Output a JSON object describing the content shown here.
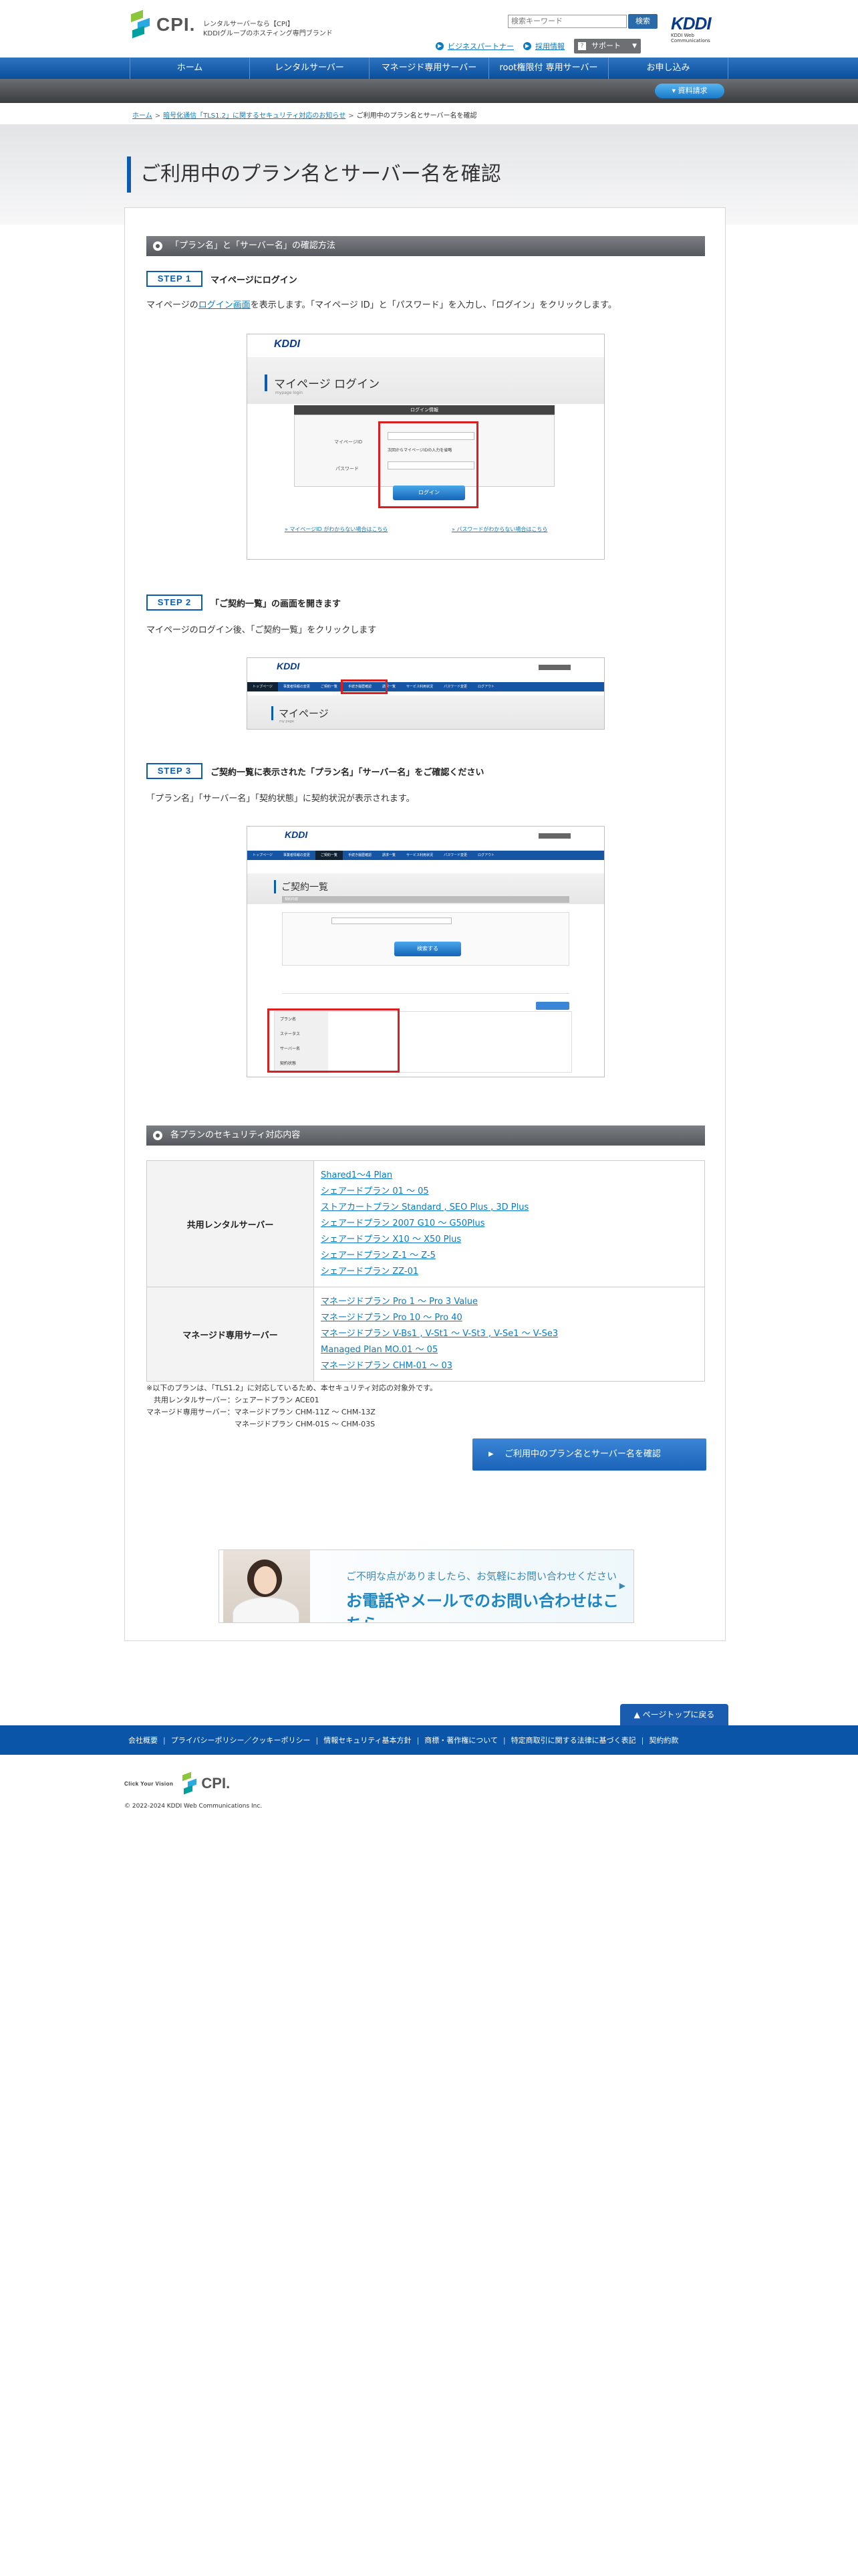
{
  "header": {
    "logo_text": "CPI.",
    "tagline_1": "レンタルサーバーなら【CPI】",
    "tagline_2": "KDDIグループのホスティング専門ブランド",
    "search_placeholder": "検索キーワード",
    "search_button": "検索",
    "kddi_logo": "KDDI",
    "kddi_sub": "KDDI Web Communications",
    "links": [
      "ビジネスパートナー",
      "採用情報"
    ],
    "support_label": "サポート"
  },
  "nav": {
    "items": [
      "ホーム",
      "レンタルサーバー",
      "マネージド専用サーバー",
      "root権限付 専用サーバー",
      "お申し込み"
    ],
    "subbar_button": "資料請求"
  },
  "breadcrumb": {
    "home": "ホーム",
    "parent": "暗号化通信「TLS1.2」に関するセキュリティ対応のお知らせ",
    "current": "ご利用中のプラン名とサーバー名を確認"
  },
  "page_title": "ご利用中のプラン名とサーバー名を確認",
  "section1": {
    "heading": "「プラン名」と「サーバー名」の確認方法",
    "step1": {
      "badge": "STEP 1",
      "title": "マイページにログイン",
      "desc_prefix": "マイページの",
      "desc_link": "ログイン画面",
      "desc_suffix": "を表示します。「マイページ ID」と「パスワード」を入力し、「ログイン」をクリックします。"
    },
    "step2": {
      "badge": "STEP 2",
      "title": "「ご契約一覧」の画面を開きます",
      "desc": "マイページのログイン後、「ご契約一覧」をクリックします"
    },
    "step3": {
      "badge": "STEP 3",
      "title": "ご契約一覧に表示された「プラン名」「サーバー名」をご確認ください",
      "desc": "「プラン名」「サーバー名」「契約状態」に契約状況が表示されます。"
    }
  },
  "shot_login": {
    "kddi": "KDDI",
    "title": "マイページ ログイン",
    "sub": "mypage login",
    "panel_title": "ログイン情報",
    "field1": "マイページID",
    "field2": "パスワード",
    "remember": "次回からマイページIDの入力を省略",
    "button": "ログイン",
    "link1": "マイページID がわからない場合はこちら",
    "link2": "パスワードがわからない場合はこちら"
  },
  "shot_mypage": {
    "kddi": "KDDI",
    "title": "マイページ",
    "sub": "my page",
    "nav": [
      "トップページ",
      "事業者情報の変更",
      "ご契約一覧",
      "手続き履歴確認",
      "請求一覧",
      "サービス利用状況",
      "パスワード変更",
      "ログアウト"
    ]
  },
  "shot_contract": {
    "kddi": "KDDI",
    "title": "ご契約一覧",
    "sub": "契約内容",
    "search_button": "検索する",
    "rows": [
      "プラン名",
      "ステータス",
      "サーバー名",
      "契約状態"
    ]
  },
  "section2": {
    "heading": "各プランのセキュリティ対応内容",
    "rows": [
      {
        "label": "共用レンタルサーバー",
        "links": [
          "Shared1～4 Plan",
          "シェアードプラン 01 ～ 05",
          "ストアカートプラン Standard , SEO Plus , 3D Plus",
          "シェアードプラン 2007 G10 ～ G50Plus",
          "シェアードプラン X10 ～ X50 Plus",
          "シェアードプラン Z-1 ～ Z-5",
          "シェアードプラン ZZ-01"
        ]
      },
      {
        "label": "マネージド専用サーバー",
        "links": [
          "マネージドプラン Pro 1 ～ Pro 3 Value",
          "マネージドプラン Pro 10 ～ Pro 40",
          "マネージドプラン V-Bs1 , V-St1 ～ V-St3 , V-Se1 ～ V-Se3",
          "Managed Plan MO.01 ～ 05",
          "マネージドプラン CHM-01 ～ 03"
        ]
      }
    ],
    "note": "※以下のプランは、「TLS1.2」に対応しているため、本セキュリティ対応の対象外です。\n　共用レンタルサーバー：シェアードプラン ACE01\nマネージド専用サーバー：マネージドプラン CHM-11Z ～ CHM-13Z\n　　　　　　　　　　　　マネージドプラン CHM-01S ～ CHM-03S",
    "confirm_button": "ご利用中のプラン名とサーバー名を確認"
  },
  "contact": {
    "line1": "ご不明な点がありましたら、お気軽にお問い合わせください",
    "line2": "お電話やメールでのお問い合わせはこちら"
  },
  "footer": {
    "pagetop": "ページトップに戻る",
    "links": [
      "会社概要",
      "プライバシーポリシー／クッキーポリシー",
      "情報セキュリティ基本方針",
      "商標・著作権について",
      "特定商取引に関する法律に基づく表記",
      "契約約款"
    ],
    "click_your_vision": "Click Your Vision",
    "logo_text": "CPI.",
    "copyright": "© 2022-2024 KDDI Web Communications Inc."
  }
}
